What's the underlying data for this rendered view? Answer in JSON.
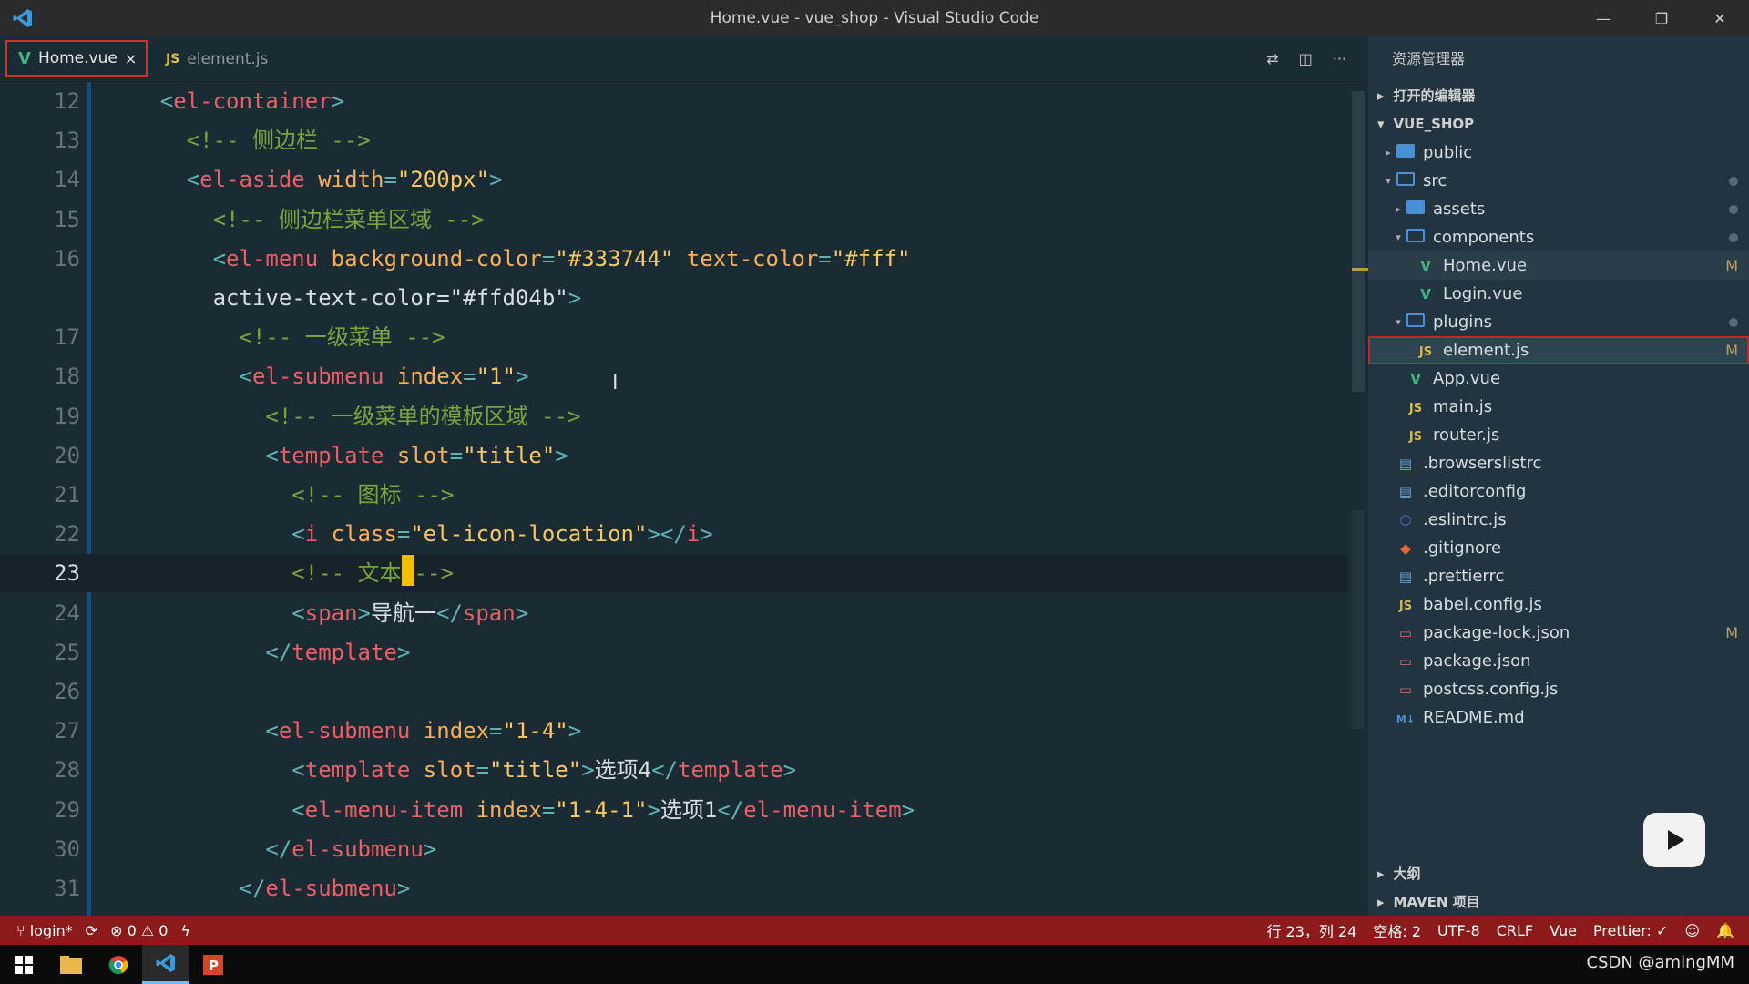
{
  "window": {
    "title": "Home.vue - vue_shop - Visual Studio Code"
  },
  "tabs": [
    {
      "label": "Home.vue",
      "icon": "V",
      "close": "×"
    },
    {
      "label": "element.js",
      "icon": "JS"
    }
  ],
  "editor": {
    "lines": [
      {
        "n": "12",
        "code": "    <el-container>"
      },
      {
        "n": "13",
        "code": "      <!-- 侧边栏 -->"
      },
      {
        "n": "14",
        "code": "      <el-aside width=\"200px\">"
      },
      {
        "n": "15",
        "code": "        <!-- 侧边栏菜单区域 -->"
      },
      {
        "n": "16",
        "code": "        <el-menu background-color=\"#333744\" text-color=\"#fff\""
      },
      {
        "n": "",
        "code": "        active-text-color=\"#ffd04b\">"
      },
      {
        "n": "17",
        "code": "          <!-- 一级菜单 -->"
      },
      {
        "n": "18",
        "code": "          <el-submenu index=\"1\">"
      },
      {
        "n": "19",
        "code": "            <!-- 一级菜单的模板区域 -->"
      },
      {
        "n": "20",
        "code": "            <template slot=\"title\">"
      },
      {
        "n": "21",
        "code": "              <!-- 图标 -->"
      },
      {
        "n": "22",
        "code": "              <i class=\"el-icon-location\"></i>"
      },
      {
        "n": "23",
        "code": "              <!-- 文本 -->"
      },
      {
        "n": "24",
        "code": "              <span>导航一</span>"
      },
      {
        "n": "25",
        "code": "            </template>"
      },
      {
        "n": "26",
        "code": ""
      },
      {
        "n": "27",
        "code": "            <el-submenu index=\"1-4\">"
      },
      {
        "n": "28",
        "code": "              <template slot=\"title\">选项4</template>"
      },
      {
        "n": "29",
        "code": "              <el-menu-item index=\"1-4-1\">选项1</el-menu-item>"
      },
      {
        "n": "30",
        "code": "            </el-submenu>"
      },
      {
        "n": "31",
        "code": "          </el-submenu>"
      }
    ]
  },
  "sidebar": {
    "title": "资源管理器",
    "open_editors": "打开的编辑器",
    "project": "VUE_SHOP",
    "tree": [
      {
        "label": "public",
        "kind": "folder-closed",
        "depth": 1
      },
      {
        "label": "src",
        "kind": "folder-open",
        "depth": 1,
        "dot": true
      },
      {
        "label": "assets",
        "kind": "folder-closed",
        "depth": 2,
        "dot": true
      },
      {
        "label": "components",
        "kind": "folder-open",
        "depth": 2,
        "dot": true
      },
      {
        "label": "Home.vue",
        "kind": "vue",
        "depth": 3,
        "badge": "M",
        "hl": true
      },
      {
        "label": "Login.vue",
        "kind": "vue",
        "depth": 3
      },
      {
        "label": "plugins",
        "kind": "folder-open",
        "depth": 2,
        "dot": true
      },
      {
        "label": "element.js",
        "kind": "js",
        "depth": 3,
        "badge": "M",
        "selected": true
      },
      {
        "label": "App.vue",
        "kind": "vue",
        "depth": 2
      },
      {
        "label": "main.js",
        "kind": "js",
        "depth": 2
      },
      {
        "label": "router.js",
        "kind": "js",
        "depth": 2
      },
      {
        "label": ".browserslistrc",
        "kind": "file",
        "depth": 1
      },
      {
        "label": ".editorconfig",
        "kind": "file",
        "depth": 1
      },
      {
        "label": ".eslintrc.js",
        "kind": "eslint",
        "depth": 1
      },
      {
        "label": ".gitignore",
        "kind": "git",
        "depth": 1
      },
      {
        "label": ".prettierrc",
        "kind": "file",
        "depth": 1
      },
      {
        "label": "babel.config.js",
        "kind": "js",
        "depth": 1
      },
      {
        "label": "package-lock.json",
        "kind": "json",
        "depth": 1,
        "badge": "M"
      },
      {
        "label": "package.json",
        "kind": "json",
        "depth": 1
      },
      {
        "label": "postcss.config.js",
        "kind": "json",
        "depth": 1
      },
      {
        "label": "README.md",
        "kind": "md",
        "depth": 1
      }
    ],
    "outline": "大纲",
    "maven": "MAVEN 项目"
  },
  "status": {
    "branch": "login*",
    "errors": "0",
    "warnings": "0",
    "position": "行 23，列 24",
    "spaces": "空格: 2",
    "encoding": "UTF-8",
    "eol": "CRLF",
    "language": "Vue",
    "prettier": "Prettier: ✓"
  },
  "watermark": "CSDN @amingMM"
}
